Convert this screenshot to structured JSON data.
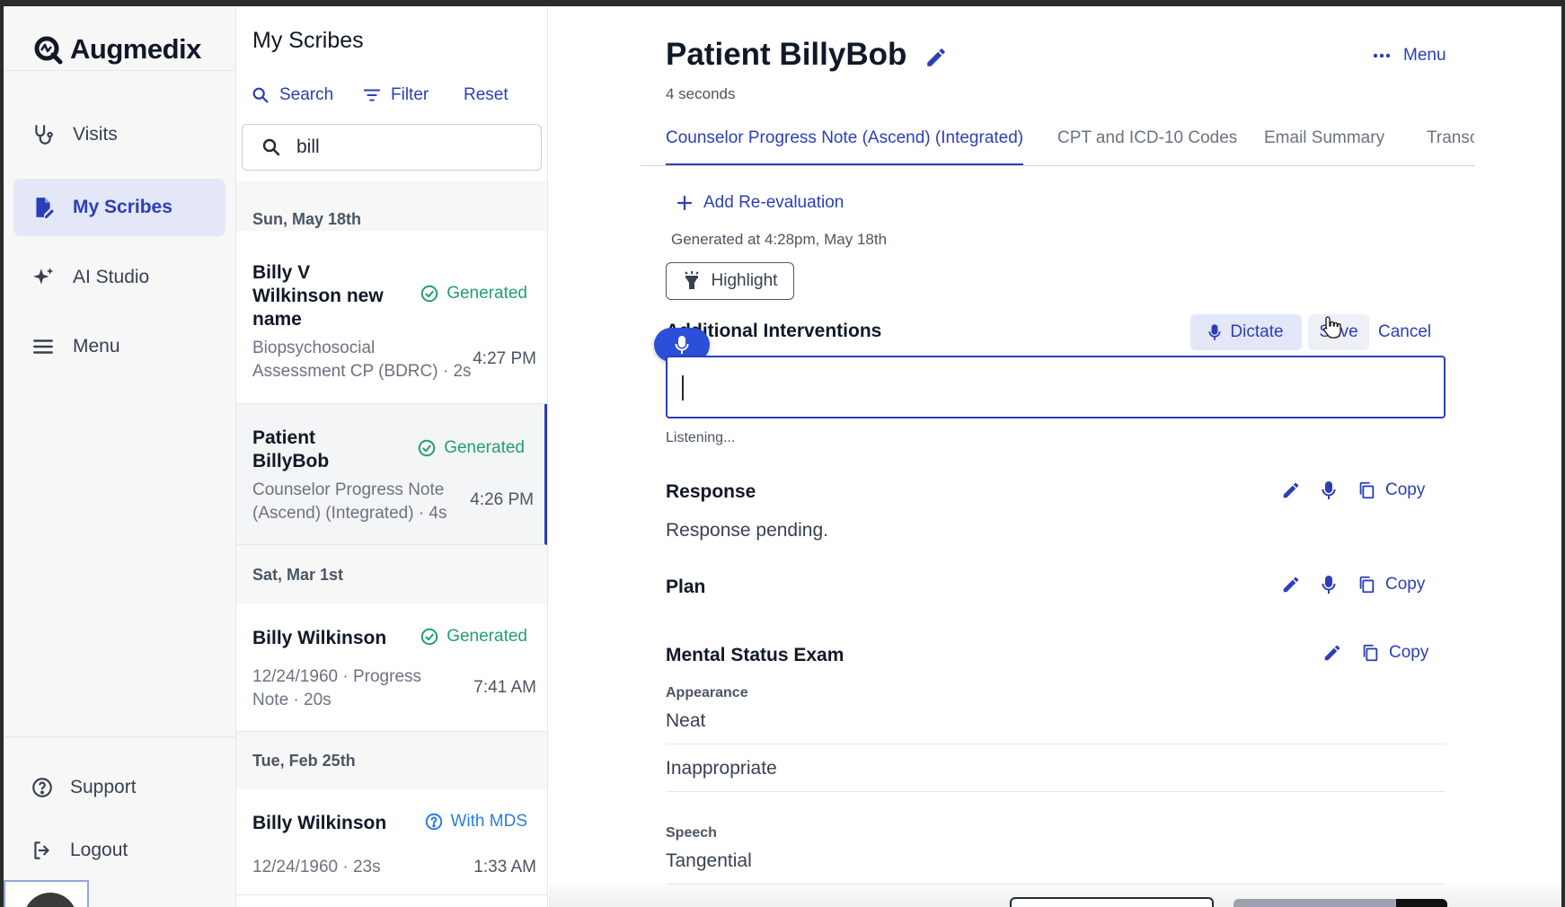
{
  "app": {
    "brand": "Augmedix"
  },
  "sidebar": {
    "items": [
      {
        "label": "Visits",
        "icon": "stethoscope-icon"
      },
      {
        "label": "My Scribes",
        "icon": "document-edit-icon",
        "active": true
      },
      {
        "label": "AI Studio",
        "icon": "sparkle-icon"
      },
      {
        "label": "Menu",
        "icon": "hamburger-icon"
      }
    ],
    "support": "Support",
    "logout": "Logout"
  },
  "list": {
    "title": "My Scribes",
    "search_label": "Search",
    "filter_label": "Filter",
    "reset_label": "Reset",
    "search_value": "bill",
    "groups": [
      {
        "date": "Sun, May 18th"
      },
      {
        "date": "Sat, Mar 1st"
      },
      {
        "date": "Tue, Feb 25th"
      }
    ],
    "items": [
      {
        "name_l1": "Billy V",
        "name_l2": "Wilkinson new",
        "name_l3": "name",
        "status": "Generated",
        "sub_l1": "Biopsychosocial",
        "sub_l2": "Assessment CP (BDRC) · 2s",
        "time": "4:27 PM"
      },
      {
        "name_l1": "Patient",
        "name_l2": "BillyBob",
        "status": "Generated",
        "sub_l1": "Counselor Progress Note",
        "sub_l2": "(Ascend) (Integrated) · 4s",
        "time": "4:26 PM",
        "selected": true
      },
      {
        "name_l1": "Billy Wilkinson",
        "status": "Generated",
        "sub_l1": "12/24/1960 · Progress",
        "sub_l2": "Note · 20s",
        "time": "7:41 AM"
      },
      {
        "name_l1": "Billy Wilkinson",
        "status": "With MDS",
        "sub_l1": "12/24/1960 · 23s",
        "time": "1:33 AM"
      }
    ]
  },
  "main": {
    "title": "Patient BillyBob",
    "subtitle": "4 seconds",
    "menu_label": "Menu",
    "tabs": [
      {
        "label": "Counselor Progress Note (Ascend) (Integrated)",
        "active": true
      },
      {
        "label": "CPT and ICD-10 Codes"
      },
      {
        "label": "Email Summary"
      },
      {
        "label": "Transcri"
      }
    ],
    "add_reeval": "Add Re-evaluation",
    "generated_at": "Generated at 4:28pm, May 18th",
    "highlight_label": "Highlight",
    "interventions": {
      "title": "Additional Interventions",
      "dictate_label": "Dictate",
      "save_label": "Save",
      "cancel_label": "Cancel",
      "input_value": "",
      "status": "Listening..."
    },
    "response": {
      "title": "Response",
      "body": "Response pending.",
      "copy_label": "Copy"
    },
    "plan": {
      "title": "Plan",
      "copy_label": "Copy"
    },
    "mse": {
      "title": "Mental Status Exam",
      "copy_label": "Copy",
      "fields": [
        {
          "label": "Appearance",
          "values": [
            "Neat",
            "Inappropriate"
          ]
        },
        {
          "label": "Speech",
          "values": [
            "Tangential"
          ]
        }
      ]
    }
  },
  "colors": {
    "accent": "#2b3fb8",
    "generated": "#22a06b",
    "mds": "#2b7de0"
  }
}
